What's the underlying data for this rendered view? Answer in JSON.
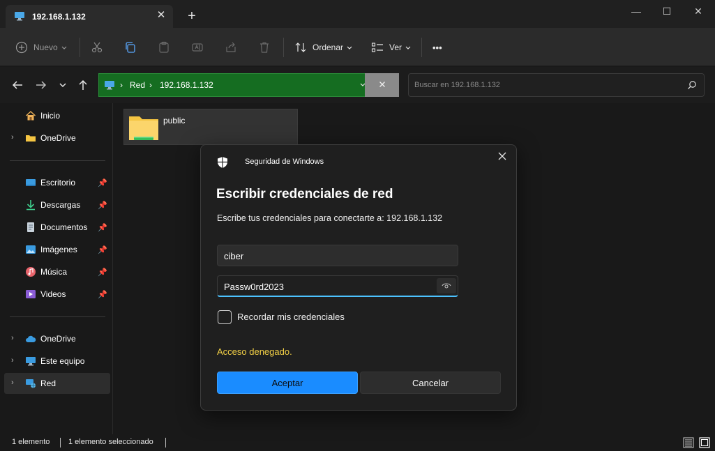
{
  "tab": {
    "title": "192.168.1.132",
    "close": "✕",
    "new_tab": "+"
  },
  "window_controls": {
    "minimize": "—",
    "maximize": "☐",
    "close": "✕"
  },
  "toolbar": {
    "new_label": "Nuevo",
    "sort_label": "Ordenar",
    "view_label": "Ver",
    "more": "•••"
  },
  "address": {
    "crumbs": [
      "Red",
      "192.168.1.132"
    ],
    "separator": "›"
  },
  "search": {
    "placeholder": "Buscar en 192.168.1.132"
  },
  "sidebar": {
    "items": [
      {
        "label": "Inicio",
        "icon": "home-icon"
      },
      {
        "label": "OneDrive",
        "icon": "folder-icon"
      },
      {
        "label": "Escritorio",
        "icon": "desktop-icon",
        "pinned": true
      },
      {
        "label": "Descargas",
        "icon": "download-icon",
        "pinned": true
      },
      {
        "label": "Documentos",
        "icon": "document-icon",
        "pinned": true
      },
      {
        "label": "Imágenes",
        "icon": "pictures-icon",
        "pinned": true
      },
      {
        "label": "Música",
        "icon": "music-icon",
        "pinned": true
      },
      {
        "label": "Videos",
        "icon": "video-icon",
        "pinned": true
      },
      {
        "label": "OneDrive",
        "icon": "cloud-icon"
      },
      {
        "label": "Este equipo",
        "icon": "pc-icon"
      },
      {
        "label": "Red",
        "icon": "network-icon"
      }
    ]
  },
  "content": {
    "folder_name": "public"
  },
  "status": {
    "count": "1 elemento",
    "selected": "1 elemento seleccionado"
  },
  "dialog": {
    "app_name": "Seguridad de Windows",
    "title": "Escribir credenciales de red",
    "description": "Escribe tus credenciales para conectarte a: 192.168.1.132",
    "username": "ciber",
    "password": "Passw0rd2023",
    "remember_label": "Recordar mis credenciales",
    "error": "Acceso denegado.",
    "ok_label": "Aceptar",
    "cancel_label": "Cancelar"
  },
  "colors": {
    "address_bar": "#156d21",
    "accent": "#1a8cff",
    "error": "#f3d046"
  }
}
